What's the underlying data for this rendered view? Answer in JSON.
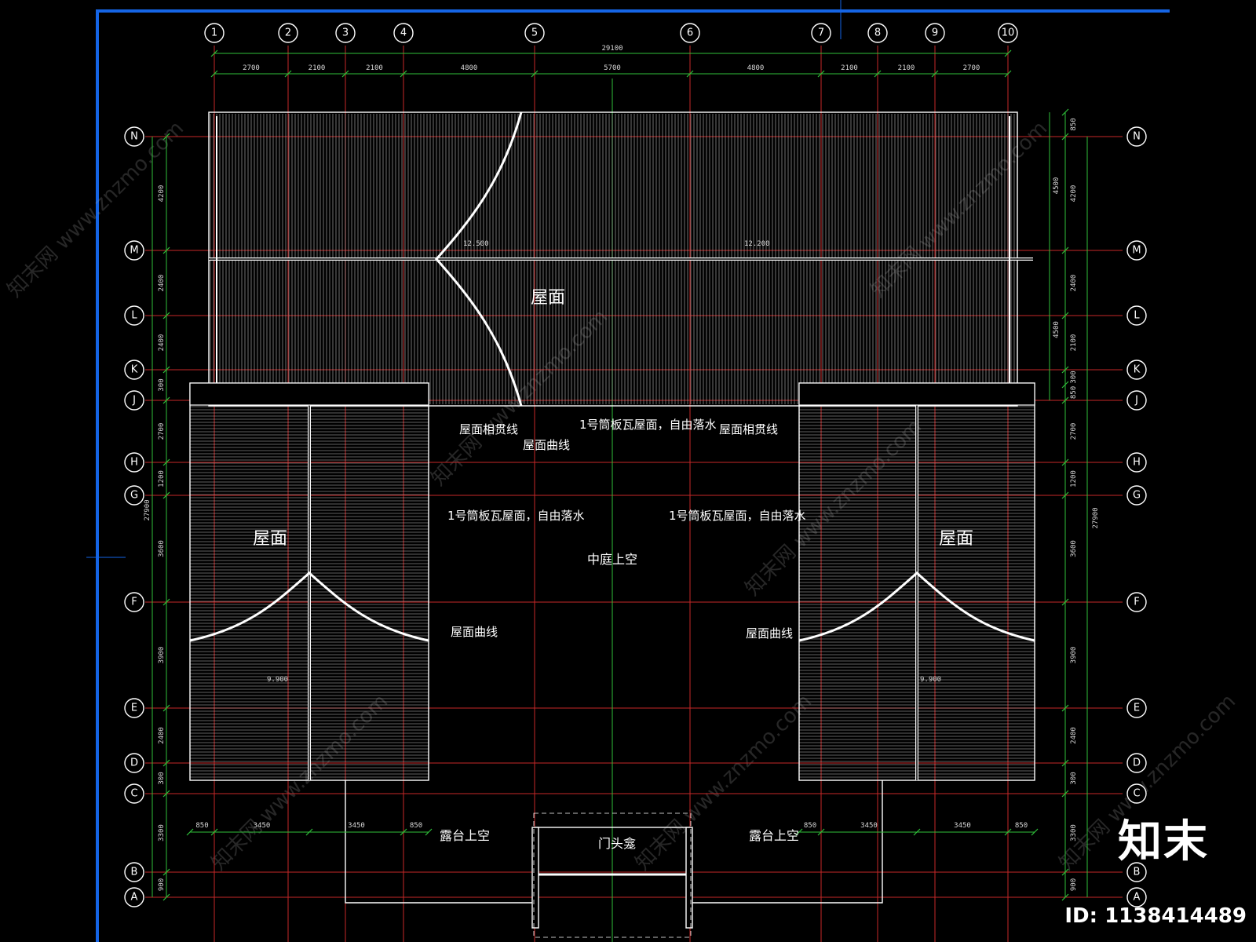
{
  "colors": {
    "background": "#000000",
    "frame": "#1565e6",
    "grid_red": "#c62828",
    "dim_green": "#2fbf3a",
    "roof": "#ffffff",
    "text": "#ffffff"
  },
  "axes": {
    "columns": [
      "1",
      "2",
      "3",
      "4",
      "5",
      "6",
      "7",
      "8",
      "9",
      "10"
    ],
    "rows": [
      "N",
      "M",
      "L",
      "K",
      "J",
      "H",
      "G",
      "F",
      "E",
      "D",
      "C",
      "B",
      "A"
    ]
  },
  "dimensions": {
    "top_total": "29100",
    "top_spans": [
      "2700",
      "2100",
      "2100",
      "4800",
      "5700",
      "4800",
      "2100",
      "2100",
      "2700"
    ],
    "left_spans": [
      "4200",
      "2400",
      "2400",
      "300",
      "2700",
      "1200",
      "3600",
      "3900",
      "2400",
      "300",
      "3300",
      "900"
    ],
    "left_total": "27900",
    "right_spans": [
      "850",
      "4200",
      "2400",
      "2100",
      "300",
      "850",
      "2700",
      "1200",
      "3600",
      "3900",
      "2400",
      "300",
      "3300",
      "900"
    ],
    "right_sub": [
      "4500",
      "4500"
    ],
    "right_total": "27900",
    "bottom_left": [
      "850",
      "3450",
      "3450",
      "850"
    ],
    "bottom_right": [
      "850",
      "3450",
      "3450",
      "850"
    ]
  },
  "labels": {
    "roof_top": "屋面",
    "roof_left": "屋面",
    "roof_right": "屋面",
    "roof_junction_left": "屋面相贯线",
    "roof_junction_right": "屋面相贯线",
    "roof_curve_top": "屋面曲线",
    "roof_curve_left": "屋面曲线",
    "roof_curve_right": "屋面曲线",
    "tile_note_top": "1号筒板瓦屋面，自由落水",
    "tile_note_left": "1号筒板瓦屋面，自由落水",
    "tile_note_right": "1号筒板瓦屋面，自由落水",
    "courtyard": "中庭上空",
    "terrace_left": "露台上空",
    "terrace_right": "露台上空",
    "gate": "门头龛",
    "elev_top_left": "12.500",
    "elev_top_right": "12.200",
    "elev_left": "9.900",
    "elev_right": "9.900"
  },
  "watermarks": [
    "知末网 www.znzmo.com"
  ],
  "brand": {
    "logo": "知末",
    "id": "ID: 1138414489"
  }
}
